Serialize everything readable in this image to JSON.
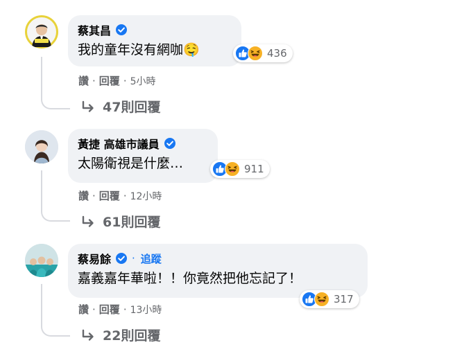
{
  "comments": [
    {
      "author": "蔡其昌",
      "verified": true,
      "text": "我的童年沒有網咖",
      "emoji": "🤤",
      "reaction_count": "436",
      "actions": {
        "like": "讚",
        "reply": "回覆",
        "time": "5小時"
      },
      "replies_label": "47則回覆"
    },
    {
      "author": "黃捷 高雄市議員",
      "verified": true,
      "text": "太陽衛視是什麼…",
      "reaction_count": "911",
      "actions": {
        "like": "讚",
        "reply": "回覆",
        "time": "12小時"
      },
      "replies_label": "61則回覆"
    },
    {
      "author": "蔡易餘",
      "verified": true,
      "follow_label": "追蹤",
      "text": "嘉義嘉年華啦！！你竟然把他忘記了！",
      "reaction_count": "317",
      "actions": {
        "like": "讚",
        "reply": "回覆",
        "time": "13小時"
      },
      "replies_label": "22則回覆"
    }
  ],
  "colors": {
    "like_blue": "#1877f2",
    "haha_yellow": "#f7b125",
    "bubble_bg": "#f0f2f5",
    "secondary_text": "#65676b"
  },
  "icons": [
    "verified-badge-icon",
    "like-reaction-icon",
    "haha-reaction-icon",
    "reply-arrow-icon",
    "drooling-face-emoji"
  ]
}
